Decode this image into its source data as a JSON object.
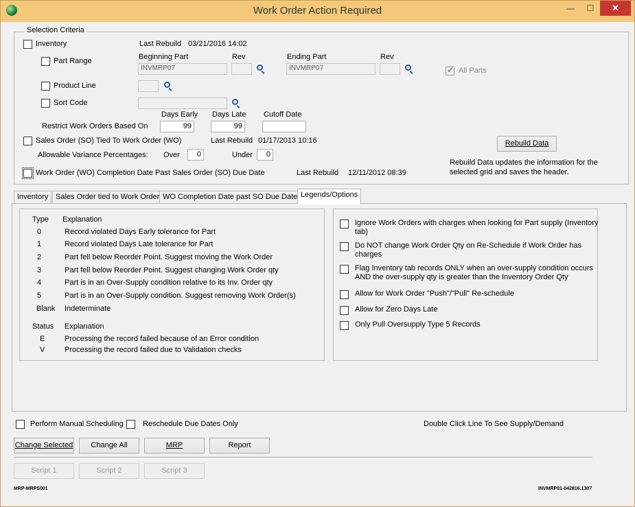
{
  "window": {
    "title": "Work Order Action Required",
    "min": "—",
    "max": "☐",
    "close": "✕"
  },
  "criteria": {
    "title": "Selection Criteria",
    "inventory_label": "Inventory",
    "last_rebuild_label": "Last Rebuild",
    "inventory_last_rebuild": "03/21/2016 14:02",
    "part_range_label": "Part Range",
    "beginning_part_label": "Beginning Part",
    "rev_label": "Rev",
    "ending_part_label": "Ending Part",
    "beginning_part": "INVMRP07",
    "ending_part": "INVMRP07",
    "all_parts_label": "All Parts",
    "product_line_label": "Product Line",
    "sort_code_label": "Sort Code",
    "days_early_label": "Days Early",
    "days_late_label": "Days Late",
    "cutoff_date_label": "Cutoff Date",
    "restrict_label": "Restrict Work Orders Based On",
    "days_early": "99",
    "days_late": "99",
    "so_label": "Sales Order (SO) Tied To Work Order (WO)",
    "so_last_rebuild": "01/17/2013 10:16",
    "variance_label": "Allowable Variance Percentages:",
    "over_label": "Over",
    "over": "0",
    "under_label": "Under",
    "under": "0",
    "rebuild_button": "Rebuild Data",
    "rebuild_info": "Rebuild Data updates the information for the",
    "rebuild_info2": "selected grid and saves the header.",
    "wo_label": "Work Order (WO) Completion Date Past Sales Order (SO) Due Date",
    "wo_last_rebuild": "12/11/2012 08:39"
  },
  "tabs": [
    "Inventory",
    "Sales Order tied to Work Order",
    "WO Completion Date past SO Due Date",
    "Legends/Options"
  ],
  "legend": {
    "type_header": "Type",
    "explanation_header": "Explanation",
    "rows": [
      {
        "type": "0",
        "text": "Record violated Days Early tolerance for Part"
      },
      {
        "type": "1",
        "text": "Record violated Days Late tolerance for Part"
      },
      {
        "type": "2",
        "text": "Part fell below Reorder Point. Suggest moving the Work Order"
      },
      {
        "type": "3",
        "text": "Part fell below Reorder Point. Suggest changing Work Order qty"
      },
      {
        "type": "4",
        "text": "Part is in an Over-Supply condition relative to its Inv. Order qty"
      },
      {
        "type": "5",
        "text": "Part is in an Over-Supply condition. Suggest removing Work Order(s)"
      },
      {
        "type": "Blank",
        "text": "Indeterminate"
      }
    ],
    "status_header": "Status",
    "status_rows": [
      {
        "code": "E",
        "text": "Processing the record failed because of an Error condition"
      },
      {
        "code": "V",
        "text": "Processing the record failed due to Validation checks"
      }
    ]
  },
  "options": [
    {
      "l1": "Ignore Work Orders with charges when looking for Part supply (Inventory",
      "l2": "tab)"
    },
    {
      "l1": "Do NOT change Work Order Qty on Re-Schedule if Work Order has",
      "l2": "charges"
    },
    {
      "l1": "Flag Inventory tab records ONLY when an over-supply condition occurs",
      "l2": "AND the over-supply qty is greater than the Inventory Order Qty"
    },
    {
      "l1": "Allow for Work Order \"Push\"/\"Pull\" Re-schedule",
      "l2": ""
    },
    {
      "l1": "Allow for Zero Days Late",
      "l2": ""
    },
    {
      "l1": "Only Pull Oversupply Type 5 Records",
      "l2": ""
    }
  ],
  "bottom": {
    "manual_label": "Perform Manual Scheduling",
    "reschedule_label": "Reschedule Due Dates Only",
    "double_click": "Double Click Line To See Supply/Demand",
    "change_selected": "Change Selected",
    "change_all": "Change All",
    "mrp": "MRP",
    "report": "Report",
    "script1": "Script 1",
    "script2": "Script 2",
    "script3": "Script 3",
    "footer_left": "MRP-MRPS001",
    "footer_right": "INVMRP01-042816.1307"
  }
}
